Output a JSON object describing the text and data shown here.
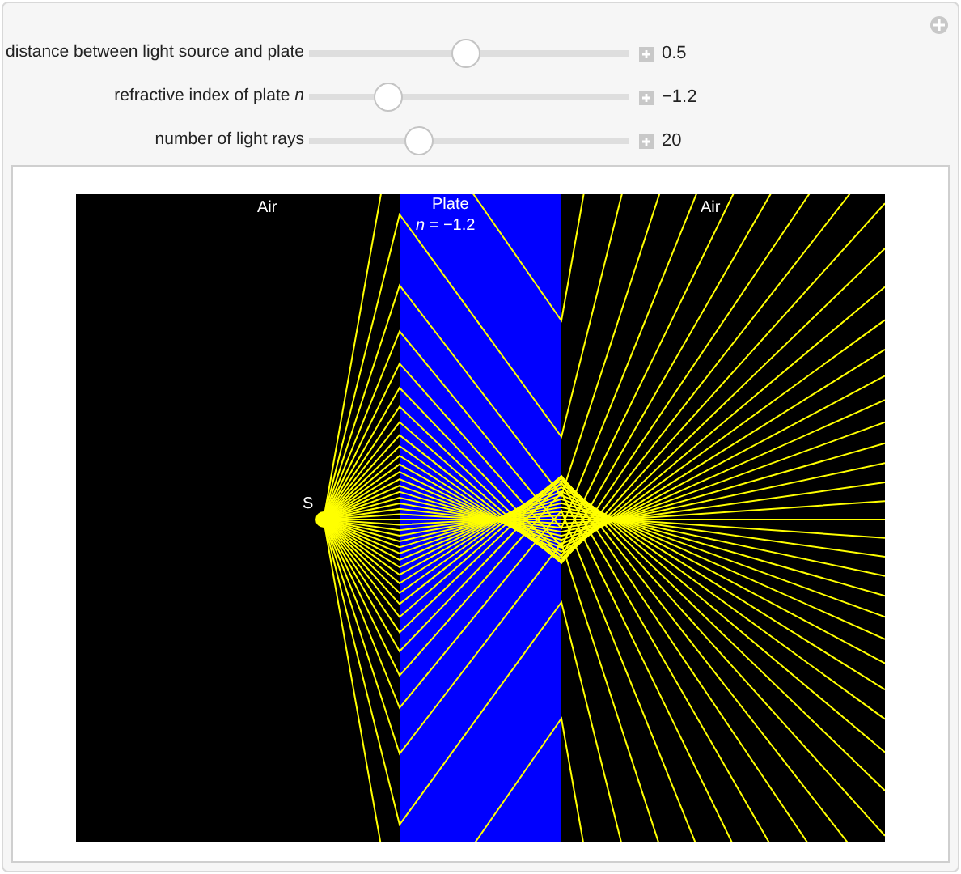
{
  "controls": [
    {
      "label": "distance between light source and plate",
      "level": 0.49,
      "value": "0.5"
    },
    {
      "label": "refractive index of plate *n*",
      "level": 0.22,
      "value": "−1.2"
    },
    {
      "label": "number of light rays",
      "level": 0.33,
      "value": "20"
    }
  ],
  "plot": {
    "labels": [
      {
        "kind": "air",
        "text": "Air"
      },
      {
        "kind": "plate",
        "text": "Plate"
      },
      {
        "kind": "index",
        "text": "*n* =  −1.2"
      },
      {
        "kind": "air2",
        "text": "Air"
      },
      {
        "kind": "source",
        "text": "S"
      }
    ]
  }
}
